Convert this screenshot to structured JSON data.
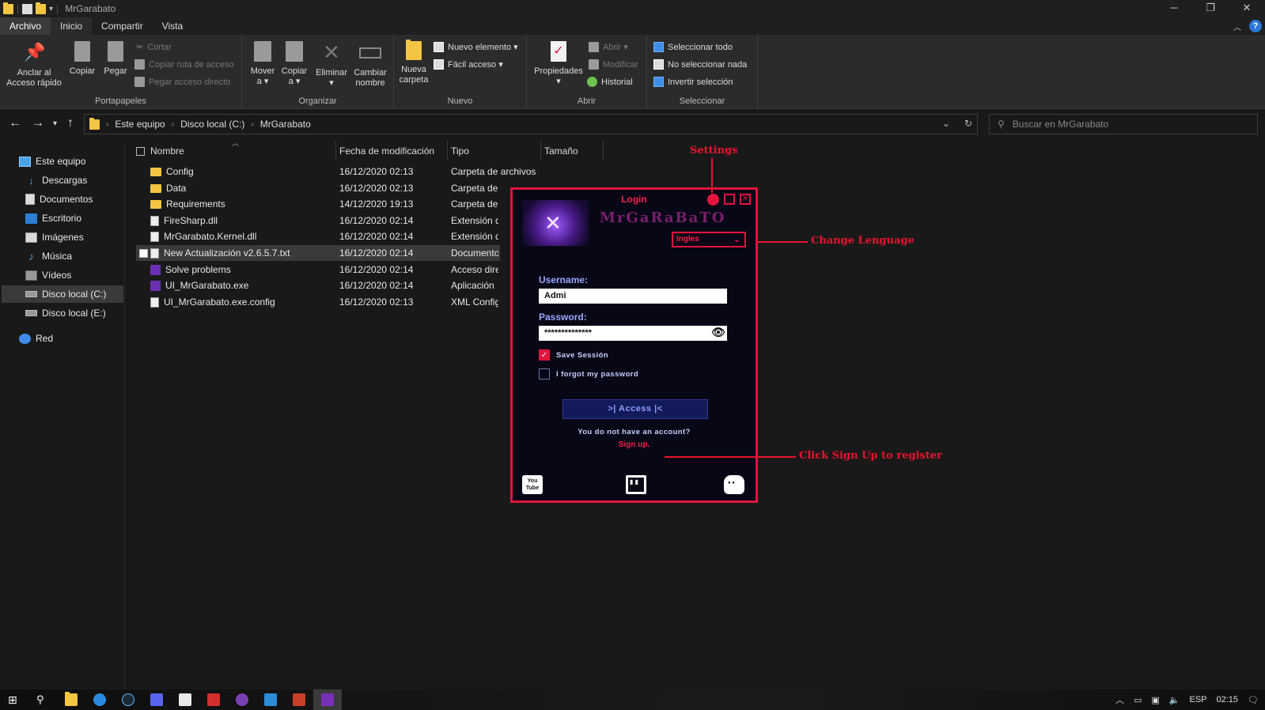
{
  "window": {
    "title": "MrGarabato",
    "controls": [
      "─",
      "❐",
      "✕"
    ]
  },
  "ribbon_tabs": [
    "Archivo",
    "Inicio",
    "Compartir",
    "Vista"
  ],
  "ribbon": {
    "portapapeles": {
      "anclar": "Anclar al",
      "anclar2": "Acceso rápido",
      "copiar": "Copiar",
      "pegar": "Pegar",
      "cortar": "Cortar",
      "copiar_ruta": "Copiar ruta de acceso",
      "pegar_acceso": "Pegar acceso directo",
      "label": "Portapapeles"
    },
    "organizar": {
      "mover": "Mover",
      "mover_sub": "a ▾",
      "copiar": "Copiar",
      "copiar_sub": "a ▾",
      "eliminar": "Eliminar",
      "eliminar_sub": "▾",
      "cambiar": "Cambiar",
      "cambiar_sub": "nombre",
      "label": "Organizar"
    },
    "nuevo": {
      "nueva_carpeta": "Nueva",
      "nueva_carpeta2": "carpeta",
      "nuevo_elemento": "Nuevo elemento ▾",
      "facil_acceso": "Fácil acceso ▾",
      "label": "Nuevo"
    },
    "abrir": {
      "propiedades": "Propiedades",
      "propiedades_sub": "▾",
      "abrir": "Abrir ▾",
      "modificar": "Modificar",
      "historial": "Historial",
      "label": "Abrir"
    },
    "seleccionar": {
      "todo": "Seleccionar todo",
      "nada": "No seleccionar nada",
      "invertir": "Invertir selección",
      "label": "Seleccionar"
    }
  },
  "address": {
    "crumbs": [
      "Este equipo",
      "Disco local (C:)",
      "MrGarabato"
    ],
    "search_placeholder": "Buscar en MrGarabato"
  },
  "sidebar": [
    {
      "label": "Este equipo",
      "icon": "computer-icon"
    },
    {
      "label": "Descargas",
      "icon": "download-icon"
    },
    {
      "label": "Documentos",
      "icon": "document-icon"
    },
    {
      "label": "Escritorio",
      "icon": "desktop-icon"
    },
    {
      "label": "Imágenes",
      "icon": "image-icon"
    },
    {
      "label": "Música",
      "icon": "music-icon"
    },
    {
      "label": "Vídeos",
      "icon": "video-icon"
    },
    {
      "label": "Disco local (C:)",
      "icon": "drive-icon",
      "selected": true
    },
    {
      "label": "Disco local (E:)",
      "icon": "drive-icon"
    },
    {
      "label": "Red",
      "icon": "network-icon"
    }
  ],
  "columns": [
    "Nombre",
    "Fecha de modificación",
    "Tipo",
    "Tamaño"
  ],
  "files": [
    {
      "name": "Config",
      "date": "16/12/2020 02:13",
      "type": "Carpeta de archivos",
      "icon": "folder"
    },
    {
      "name": "Data",
      "date": "16/12/2020 02:13",
      "type": "Carpeta de",
      "icon": "folder"
    },
    {
      "name": "Requirements",
      "date": "14/12/2020 19:13",
      "type": "Carpeta de",
      "icon": "folder"
    },
    {
      "name": "FireSharp.dll",
      "date": "16/12/2020 02:14",
      "type": "Extensión d",
      "icon": "file"
    },
    {
      "name": "MrGarabato.Kernel.dll",
      "date": "16/12/2020 02:14",
      "type": "Extensión d",
      "icon": "file"
    },
    {
      "name": "New Actualización v2.6.5.7.txt",
      "date": "16/12/2020 02:14",
      "type": "Documento",
      "icon": "file",
      "highlight": true
    },
    {
      "name": "Solve problems",
      "date": "16/12/2020 02:14",
      "type": "Acceso dire",
      "icon": "exe"
    },
    {
      "name": "UI_MrGarabato.exe",
      "date": "16/12/2020 02:14",
      "type": "Aplicación",
      "icon": "exe"
    },
    {
      "name": "UI_MrGarabato.exe.config",
      "date": "16/12/2020 02:13",
      "type": "XML Config",
      "icon": "file"
    }
  ],
  "login": {
    "title": "Login",
    "brand": "MrGaRaBaTO",
    "language": "Ingles",
    "username_label": "Username:",
    "username_value": "Admi",
    "password_label": "Password:",
    "password_value": "**************",
    "save_session": "Save Sessión",
    "forgot": "I forgot my password",
    "access": ">| Access |<",
    "no_account": "You do not have an account?",
    "signup": "Sign up.",
    "youtube": "You Tube"
  },
  "annotations": {
    "settings": "Settings",
    "language": "Change Lenguage",
    "signup": "Click Sign Up to register"
  },
  "tray": {
    "lang": "ESP",
    "time": "02:15"
  },
  "colors": {
    "accent_red": "#e3143e",
    "login_bg": "#080716",
    "explorer_bg": "#191919"
  }
}
